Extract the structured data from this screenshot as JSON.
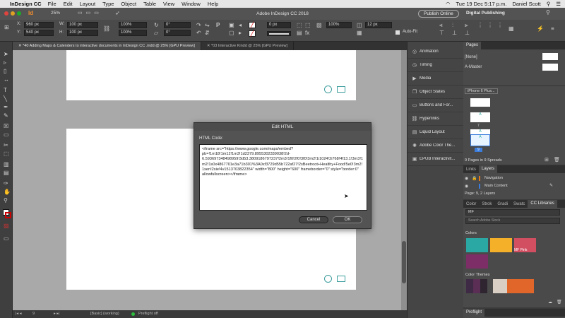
{
  "menubar": {
    "app_name": "InDesign CC",
    "items": [
      "File",
      "Edit",
      "Layout",
      "Type",
      "Object",
      "Table",
      "View",
      "Window",
      "Help"
    ],
    "clock": "Tue 19 Dec  5:17 p.m.",
    "user": "Daniel Scott"
  },
  "titlebar": {
    "title": "Adobe InDesign CC 2018",
    "zoom": "25%",
    "publish_button": "Publish Online",
    "workspace": "Digital Publishing"
  },
  "control": {
    "x": "960 px",
    "y": "540 px",
    "w": "100 px",
    "h": "100 px",
    "scale_x": "100%",
    "scale_y": "100%",
    "rotate": "0°",
    "shear": "0°",
    "stroke_weight": "0 px",
    "percent": "100%",
    "size": "12 px",
    "auto_fit": "Auto-Fit"
  },
  "tabs": [
    {
      "label": "*40 Adding Maps & Calenders to interactive documents in InDesign CC .indd @ 25% [GPU Preview]"
    },
    {
      "label": "*03 Interactive Kindd @ 25% [GPU Preview]"
    }
  ],
  "status": {
    "page": "9",
    "style": "[Basic] (working)",
    "preflight": "Preflight off"
  },
  "dialog": {
    "title": "Edit HTML",
    "label": "HTML Code:",
    "code": "<iframe src=\"https://www.google.com/maps/embed?pb=!1m18!1m12!1m3!1d2379.8955302339038!2d-6.593697348498959!3d53.3809186797237!2m3!1f0!2f0!3f0!3m2!1i1024!2i768!4f13.1!3m3!1m2!1s0x4867701e3a71b301%3A0xf3729d55b722af27!2sBeetroot+Healthy+Food!5e0!3m2!1sen!2sie!4v1513703822354\" width=\"800\" height=\"600\" frameborder=\"0\" style=\"border:0\" allowfullscreen></iframe>",
    "cancel": "Cancel",
    "ok": "OK"
  },
  "strip": {
    "items": [
      "Animation",
      "Timing",
      "Media",
      "Object States",
      "Buttons and For...",
      "Hyperlinks",
      "Liquid Layout",
      "Adobe Color The...",
      "EPUB Interactivit..."
    ]
  },
  "pages": {
    "tab": "Pages",
    "none": "[None]",
    "master": "A-Master",
    "preset": "iPhone 6 Plus...",
    "thumbs": [
      "7",
      "8",
      "9"
    ],
    "footer": "9 Pages in 9 Spreads"
  },
  "layers": {
    "tabs": [
      "Links",
      "Layers"
    ],
    "rows": [
      "Navigation",
      "Main Content"
    ],
    "footer": "Page: 9, 2 Layers"
  },
  "cc": {
    "tabs": [
      "Color",
      "Strok",
      "Gradi",
      "Swatc",
      "CC Libraries"
    ],
    "library": "MF",
    "search": "Search Adobe Stock",
    "colors_title": "Colors",
    "swatch_label": "MF Pink",
    "themes_title": "Color Themes",
    "preflight": "Preflight"
  },
  "colors": {
    "teal": "#2aa8a3",
    "yellow": "#f4b028",
    "pink": "#d24f62",
    "purple": "#7d2e67"
  }
}
